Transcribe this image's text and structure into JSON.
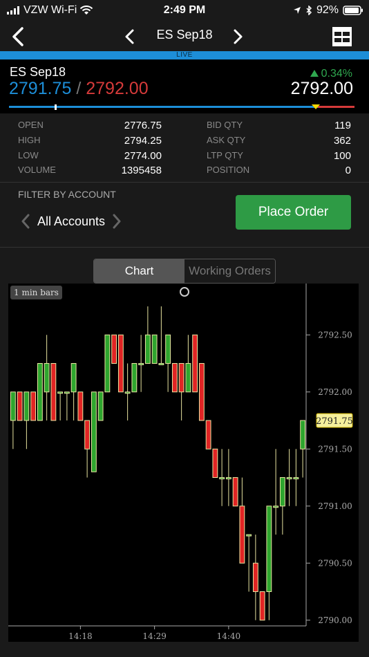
{
  "status_bar": {
    "carrier": "VZW Wi-Fi",
    "time": "2:49 PM",
    "battery": "92%"
  },
  "nav": {
    "title": "ES Sep18"
  },
  "live_label": "LIVE",
  "quote": {
    "symbol": "ES Sep18",
    "bid": "2791.75",
    "separator": "/",
    "ask": "2792.00",
    "change": "0.34%",
    "last": "2792.00"
  },
  "stats": {
    "open_label": "OPEN",
    "open": "2776.75",
    "high_label": "HIGH",
    "high": "2794.25",
    "low_label": "LOW",
    "low": "2774.00",
    "volume_label": "VOLUME",
    "volume": "1395458",
    "bid_qty_label": "BID QTY",
    "bid_qty": "119",
    "ask_qty_label": "ASK QTY",
    "ask_qty": "362",
    "ltp_qty_label": "LTP QTY",
    "ltp_qty": "100",
    "position_label": "POSITION",
    "position": "0"
  },
  "filter": {
    "label": "FILTER BY ACCOUNT",
    "account": "All Accounts"
  },
  "place_order": "Place Order",
  "tabs": {
    "chart": "Chart",
    "working_orders": "Working Orders"
  },
  "colors": {
    "accent": "#1d8ed8",
    "up": "#2ea52e",
    "down": "#e02424",
    "button": "#2e9b45"
  },
  "chart_data": {
    "type": "candlestick",
    "period_label": "1 min bars",
    "ylim": [
      2789.95,
      2792.95
    ],
    "y_ticks": [
      {
        "value": 2792.5,
        "label": "2792.50"
      },
      {
        "value": 2792.0,
        "label": "2792.00"
      },
      {
        "value": 2791.5,
        "label": "2791.50"
      },
      {
        "value": 2791.0,
        "label": "2791.00"
      },
      {
        "value": 2790.5,
        "label": "2790.50"
      },
      {
        "value": 2790.0,
        "label": "2790.00"
      }
    ],
    "x_ticks": [
      {
        "index": 10,
        "label": "14:18"
      },
      {
        "index": 21,
        "label": "14:29"
      },
      {
        "index": 32,
        "label": "14:40"
      }
    ],
    "last_price": {
      "value": 2791.75,
      "label": "2791.75"
    },
    "candles": [
      {
        "o": 2791.75,
        "h": 2792.0,
        "l": 2791.5,
        "c": 2792.0
      },
      {
        "o": 2792.0,
        "h": 2792.0,
        "l": 2791.75,
        "c": 2791.75
      },
      {
        "o": 2791.75,
        "h": 2792.0,
        "l": 2791.5,
        "c": 2792.0
      },
      {
        "o": 2792.0,
        "h": 2792.0,
        "l": 2791.75,
        "c": 2791.75
      },
      {
        "o": 2791.75,
        "h": 2792.25,
        "l": 2791.75,
        "c": 2792.25
      },
      {
        "o": 2792.0,
        "h": 2792.5,
        "l": 2791.75,
        "c": 2792.25
      },
      {
        "o": 2792.25,
        "h": 2792.25,
        "l": 2791.75,
        "c": 2791.75
      },
      {
        "o": 2792.0,
        "h": 2792.0,
        "l": 2791.75,
        "c": 2792.0
      },
      {
        "o": 2792.0,
        "h": 2792.0,
        "l": 2791.75,
        "c": 2792.0
      },
      {
        "o": 2792.0,
        "h": 2792.25,
        "l": 2791.75,
        "c": 2792.25
      },
      {
        "o": 2792.0,
        "h": 2792.0,
        "l": 2791.75,
        "c": 2791.75
      },
      {
        "o": 2791.75,
        "h": 2791.75,
        "l": 2791.25,
        "c": 2791.5
      },
      {
        "o": 2791.3,
        "h": 2792.0,
        "l": 2791.3,
        "c": 2792.0
      },
      {
        "o": 2791.75,
        "h": 2792.0,
        "l": 2791.75,
        "c": 2792.0
      },
      {
        "o": 2792.0,
        "h": 2792.5,
        "l": 2792.0,
        "c": 2792.5
      },
      {
        "o": 2792.5,
        "h": 2792.5,
        "l": 2792.25,
        "c": 2792.25
      },
      {
        "o": 2792.5,
        "h": 2792.5,
        "l": 2792.0,
        "c": 2792.0
      },
      {
        "o": 2792.0,
        "h": 2792.25,
        "l": 2791.75,
        "c": 2792.0
      },
      {
        "o": 2792.0,
        "h": 2792.25,
        "l": 2792.0,
        "c": 2792.25
      },
      {
        "o": 2792.25,
        "h": 2792.5,
        "l": 2792.0,
        "c": 2792.25
      },
      {
        "o": 2792.25,
        "h": 2792.75,
        "l": 2792.25,
        "c": 2792.5
      },
      {
        "o": 2792.25,
        "h": 2792.5,
        "l": 2792.25,
        "c": 2792.5
      },
      {
        "o": 2792.25,
        "h": 2792.75,
        "l": 2792.25,
        "c": 2792.25
      },
      {
        "o": 2792.25,
        "h": 2792.5,
        "l": 2792.0,
        "c": 2792.5
      },
      {
        "o": 2792.25,
        "h": 2792.25,
        "l": 2792.0,
        "c": 2792.0
      },
      {
        "o": 2792.25,
        "h": 2792.25,
        "l": 2791.75,
        "c": 2792.0
      },
      {
        "o": 2792.0,
        "h": 2792.5,
        "l": 2792.0,
        "c": 2792.25
      },
      {
        "o": 2792.5,
        "h": 2792.5,
        "l": 2792.0,
        "c": 2792.0
      },
      {
        "o": 2792.25,
        "h": 2792.25,
        "l": 2791.75,
        "c": 2791.75
      },
      {
        "o": 2791.75,
        "h": 2791.75,
        "l": 2791.5,
        "c": 2791.5
      },
      {
        "o": 2791.5,
        "h": 2791.5,
        "l": 2791.25,
        "c": 2791.25
      },
      {
        "o": 2791.25,
        "h": 2791.5,
        "l": 2791.0,
        "c": 2791.25
      },
      {
        "o": 2791.25,
        "h": 2791.5,
        "l": 2791.0,
        "c": 2791.25
      },
      {
        "o": 2791.25,
        "h": 2791.25,
        "l": 2791.0,
        "c": 2791.0
      },
      {
        "o": 2791.0,
        "h": 2791.25,
        "l": 2790.5,
        "c": 2790.5
      },
      {
        "o": 2790.75,
        "h": 2790.75,
        "l": 2790.25,
        "c": 2790.75
      },
      {
        "o": 2790.5,
        "h": 2790.75,
        "l": 2790.0,
        "c": 2790.25
      },
      {
        "o": 2790.25,
        "h": 2790.25,
        "l": 2790.0,
        "c": 2790.0
      },
      {
        "o": 2790.25,
        "h": 2791.0,
        "l": 2790.0,
        "c": 2791.0
      },
      {
        "o": 2791.0,
        "h": 2791.5,
        "l": 2790.75,
        "c": 2791.0
      },
      {
        "o": 2791.0,
        "h": 2791.25,
        "l": 2790.75,
        "c": 2791.25
      },
      {
        "o": 2791.25,
        "h": 2791.5,
        "l": 2791.0,
        "c": 2791.25
      },
      {
        "o": 2791.25,
        "h": 2791.5,
        "l": 2791.0,
        "c": 2791.25
      },
      {
        "o": 2791.5,
        "h": 2791.75,
        "l": 2791.25,
        "c": 2791.75
      }
    ]
  }
}
